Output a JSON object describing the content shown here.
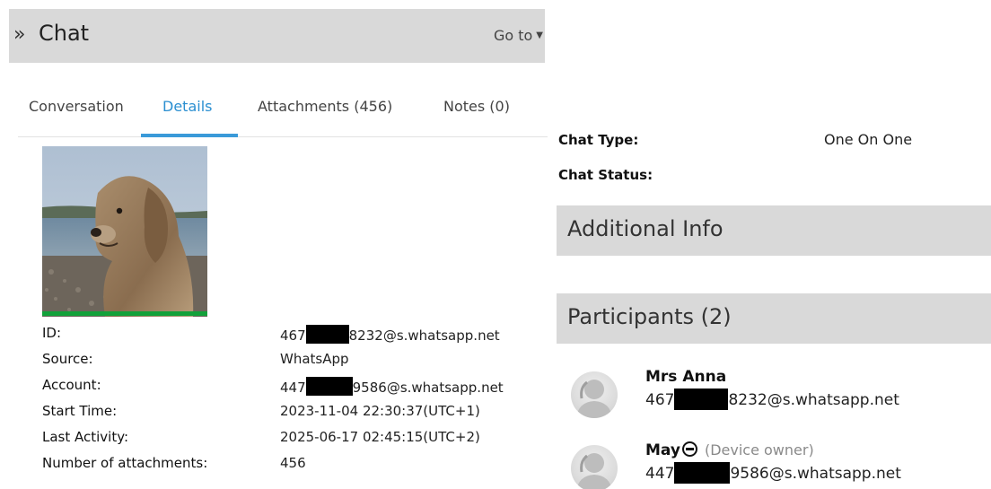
{
  "header": {
    "title": "Chat",
    "goto_label": "Go to"
  },
  "tabs": [
    {
      "label": "Conversation",
      "active": false
    },
    {
      "label": "Details",
      "active": true
    },
    {
      "label": "Attachments (456)",
      "active": false
    },
    {
      "label": "Notes (0)",
      "active": false
    }
  ],
  "details": [
    {
      "label": "ID:",
      "value_pre": "467",
      "value_post": "8232@s.whatsapp.net",
      "redacted": true
    },
    {
      "label": "Source:",
      "value_pre": "WhatsApp",
      "value_post": "",
      "redacted": false
    },
    {
      "label": "Account:",
      "value_pre": "447",
      "value_post": "9586@s.whatsapp.net",
      "redacted": true
    },
    {
      "label": "Start Time:",
      "value_pre": "2023-11-04 22:30:37(UTC+1)",
      "value_post": "",
      "redacted": false
    },
    {
      "label": "Last Activity:",
      "value_pre": "2025-06-17 02:45:15(UTC+2)",
      "value_post": "",
      "redacted": false
    },
    {
      "label": "Number of attachments:",
      "value_pre": "456",
      "value_post": "",
      "redacted": false
    }
  ],
  "chat_info": {
    "chat_type_label": "Chat Type:",
    "chat_type_value": "One On One",
    "chat_status_label": "Chat Status:",
    "chat_status_value": ""
  },
  "sections": {
    "additional_info": "Additional Info",
    "participants": "Participants (2)"
  },
  "participants": [
    {
      "name": "Mrs Anna",
      "owner_tag": "",
      "jid_pre": "467",
      "jid_post": "8232@s.whatsapp.net"
    },
    {
      "name": "May",
      "owner_tag": "(Device owner)",
      "jid_pre": "447",
      "jid_post": "9586@s.whatsapp.net"
    }
  ],
  "colors": {
    "header_bg": "#d9d9d9",
    "active_tab": "#2b8fd1",
    "avatar_status": "#12a13a",
    "redaction": "#000000"
  },
  "icons": {
    "header_expand": "double-chevron-right-icon",
    "goto_caret": "caret-down-icon",
    "participant_avatar": "default-avatar-icon"
  }
}
